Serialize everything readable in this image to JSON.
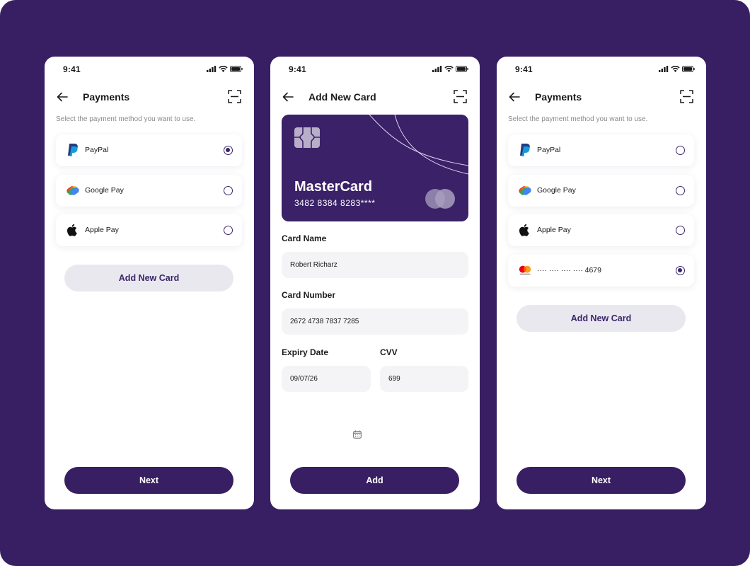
{
  "colors": {
    "background": "#381e63",
    "primary": "#381e63",
    "light_button": "#eae8ef",
    "card": "#3a2168"
  },
  "status_bar": {
    "time": "9:41"
  },
  "screen1": {
    "title": "Payments",
    "subtitle": "Select the payment method you want to use.",
    "options": [
      {
        "label": "PayPal",
        "icon": "paypal-icon",
        "selected": true
      },
      {
        "label": "Google Pay",
        "icon": "google-pay-icon",
        "selected": false
      },
      {
        "label": "Apple Pay",
        "icon": "apple-icon",
        "selected": false
      }
    ],
    "add_card_label": "Add New Card",
    "next_label": "Next"
  },
  "screen2": {
    "title": "Add New Card",
    "card": {
      "brand": "MasterCard",
      "number": "3482 8384 8283****"
    },
    "card_name_label": "Card Name",
    "card_name_value": "Robert Richarz",
    "card_number_label": "Card Number",
    "card_number_value": "2672 4738 7837 7285",
    "expiry_label": "Expiry Date",
    "expiry_value": "09/07/26",
    "cvv_label": "CVV",
    "cvv_value": "699",
    "add_label": "Add"
  },
  "screen3": {
    "title": "Payments",
    "subtitle": "Select the payment method you want to use.",
    "options": [
      {
        "label": "PayPal",
        "icon": "paypal-icon",
        "selected": false
      },
      {
        "label": "Google Pay",
        "icon": "google-pay-icon",
        "selected": false
      },
      {
        "label": "Apple Pay",
        "icon": "apple-icon",
        "selected": false
      },
      {
        "label": "···· ···· ···· ···· 4679",
        "icon": "mastercard-icon",
        "selected": true
      }
    ],
    "add_card_label": "Add New Card",
    "next_label": "Next"
  }
}
